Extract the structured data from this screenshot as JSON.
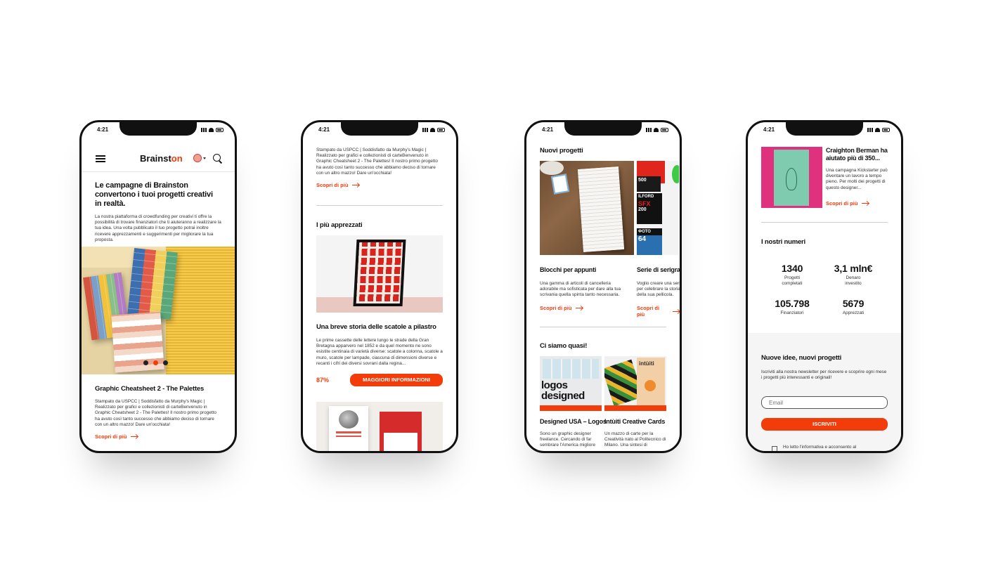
{
  "status_time": "4:21",
  "brand": {
    "prefix": "Brainst",
    "suffix": "on",
    "accent": "#f23c0a"
  },
  "phone1": {
    "hero_title": "Le campagne di Brainston convertono i tuoi progetti creativi in realtà.",
    "hero_text": "La nostra piattaforma di crowdfunding per creativi ti offre la possibilità di trovare finanziatori che ti aiuteranno a realizzare la tua idea. Una volta pubblicato il tuo progetto potrai inoltre ricevere apprezzamenti e suggerimenti per migliorare la tua proposta.",
    "card_title": "Graphic Cheatsheet 2 - The Palettes",
    "card_text": "Stampato da USPCC | Soddisfatto da Murphy's Magic | Realizzato per grafici e collezionisti di carteBenvenuto in Graphic Cheatsheet 2 - The Palettes! Il nostro primo progetto ha avuto così tanto successo che abbiamo deciso di tornare con un altro mazzo! Dare un'occhiata!",
    "link": "Scopri di più",
    "carousel_active": 2
  },
  "phone2": {
    "intro_text": "Stampato da USPCC | Soddisfatto da Murphy's Magic | Realizzato per grafici e collezionisti di carteBenvenuto in Graphic Cheatsheet 2 - The Palettes! Il nostro primo progetto ha avuto così tanto successo che abbiamo deciso di tornare con un altro mazzo! Dare un'occhiata!",
    "link": "Scopri di più",
    "section": "I più apprezzati",
    "card_title": "Una breve storia delle scatole a pilastro",
    "card_text": "Le prime cassette delle lettere lungo le strade della Gran Bretagna apparvero nel 1852 e da quel momento ne sono esistite centinaia di varietà diverse: scatole a colonna, scatole a muro, scatole per lampade, ciascuna di dimensioni diverse e recanti i cifri dei diversi sovrani dalla regina...",
    "percent": "87%",
    "cta": "MAGGIORI INFORMAZIONI"
  },
  "phone3": {
    "section1": "Nuovi progetti",
    "item1_title": "Blocchi per appunti",
    "item1_text": "Una gamma di articoli di cancelleria adorabile ma sofisticata per dare alla tua scrivania quella spinta tanto necessaria.",
    "item2_title": "Serie di serigrafie",
    "item2_text": "Voglio creare una serie per celebrare la storia della sua pellicola.",
    "link": "Scopri di più",
    "section2": "Ci siamo quasi!",
    "item3_title": "Designed USA – Logos",
    "item3_text": "Sono un graphic designer freelance. Cercando di far sembrare l'America migliore",
    "item4_title": "Intùiti Creative Cards",
    "item4_text": "Un mazzo di carte per la Creatività nato al Politecnico di Milano. Una sintesi di",
    "logos_text": "logos designed",
    "intuiti_text": "intùiti",
    "film_labels": [
      "500",
      "ILFORD",
      "SFX",
      "200",
      "ФОТО",
      "64"
    ]
  },
  "phone4": {
    "card_title": "Craighton Berman ha aiutato più di 350...",
    "card_text": "Una campagna Kickstarter può diventare un lavoro a tempo pieno. Per molti dei progetti di questo designer...",
    "link": "Scopri di più",
    "section": "I nostri numeri",
    "stats": [
      {
        "value": "1340",
        "label": "Progetti completati"
      },
      {
        "value": "3,1 mln€",
        "label": "Denaro investito"
      },
      {
        "value": "105.798",
        "label": "Finanziatori"
      },
      {
        "value": "5679",
        "label": "Apprezzati"
      }
    ],
    "newsletter_title": "Nuove idee, nuovi progetti",
    "newsletter_text": "Iscriviti alla nostra newsletter per ricevere e scoprire ogni mese i progetti più interessanti e originali!",
    "email_placeholder": "Email",
    "subscribe": "ISCRIVITI",
    "consent": "Ho letto l'informativa e acconsento al"
  }
}
